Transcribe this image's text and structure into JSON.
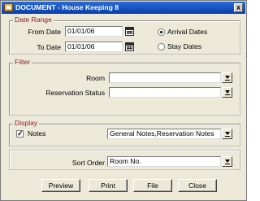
{
  "window": {
    "title": "DOCUMENT - House Keeping 8",
    "close_glyph": "x"
  },
  "date_range": {
    "title": "Date Range",
    "from_label": "From Date",
    "from_value": "01/01/06",
    "to_label": "To Date",
    "to_value": "01/01/06",
    "options": [
      {
        "label": "Arrival Dates",
        "checked": true
      },
      {
        "label": "Stay Dates",
        "checked": false
      }
    ]
  },
  "filter": {
    "title": "Filter",
    "room_label": "Room",
    "room_value": "",
    "reservation_status_label": "Reservation Status",
    "reservation_status_value": ""
  },
  "display": {
    "title": "Display",
    "notes_label": "Notes",
    "notes_checked": true,
    "notes_check_glyph": "✓",
    "notes_value": "General Notes,Reservation Notes"
  },
  "sort": {
    "label": "Sort Order",
    "value": "Room No."
  },
  "buttons": {
    "preview": "Preview",
    "print": "Print",
    "file": "File",
    "close": "Close"
  },
  "icons": {
    "calendar": "calendar-icon",
    "dropdown": "dropdown-arrow-icon"
  }
}
